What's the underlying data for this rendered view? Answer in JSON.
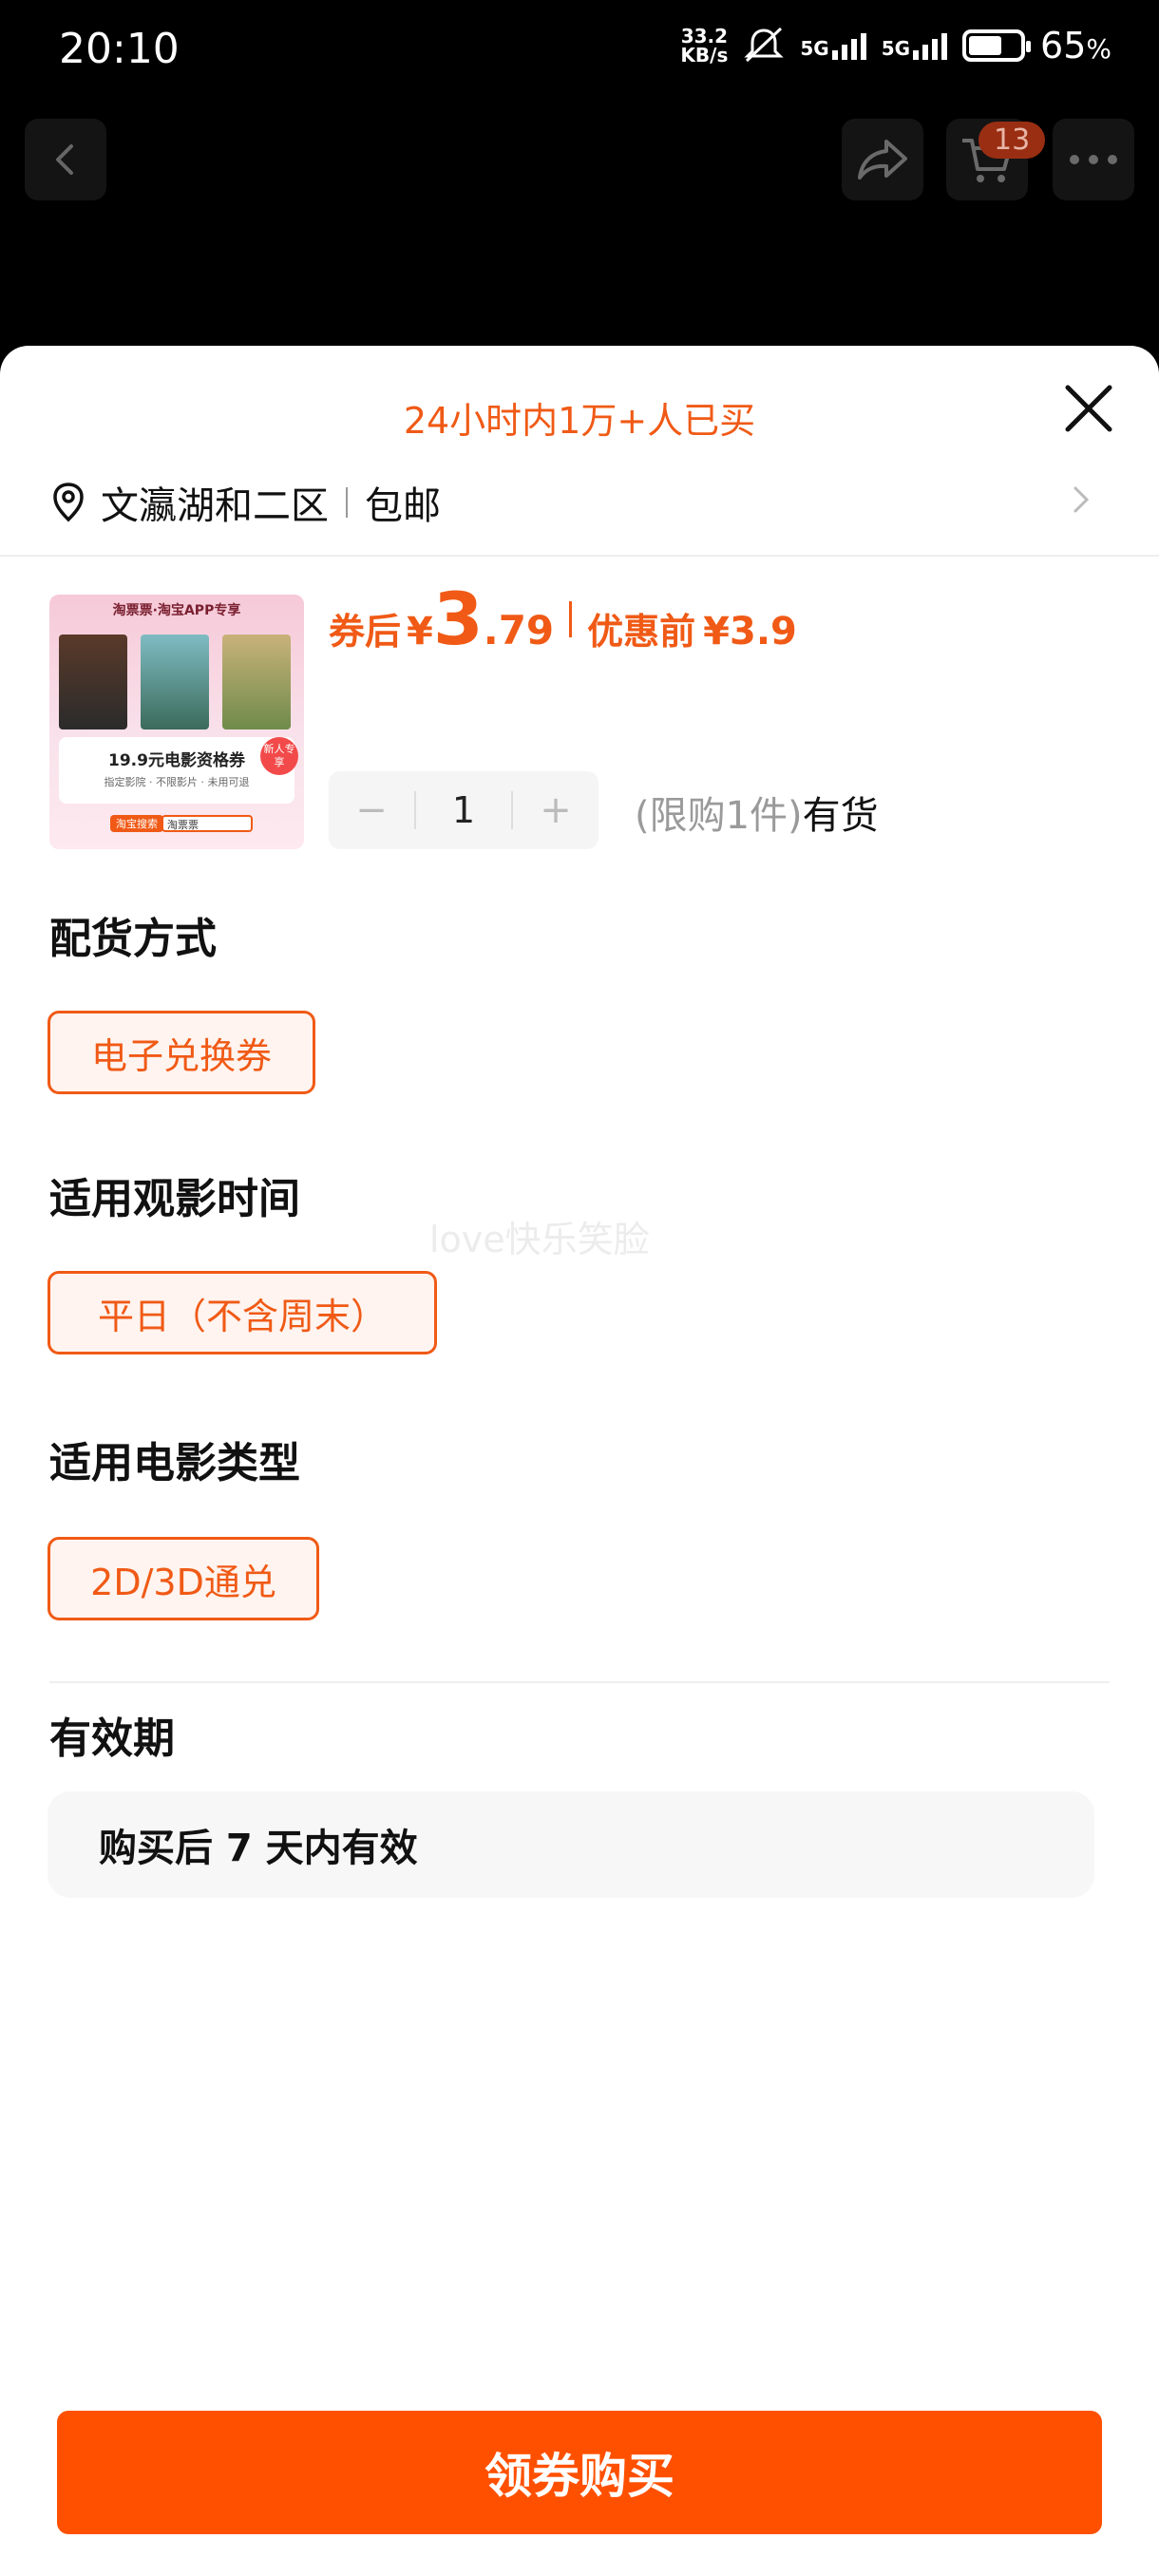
{
  "status_bar": {
    "time": "20:10",
    "net_speed_value": "33.2",
    "net_speed_unit": "KB/s",
    "sim1_label": "5G",
    "sim2_label": "5G",
    "battery_percent": "65",
    "battery_unit": "%",
    "battery_level": 0.65
  },
  "nav": {
    "cart_count": "13",
    "icons": [
      "back-icon",
      "share-icon",
      "cart-icon",
      "more-icon"
    ]
  },
  "sheet": {
    "sold_tip": "24小时内1万+人已买",
    "address": "文瀛湖和二区",
    "shipping": "包邮",
    "product_image": {
      "header": "淘票票·淘宝APP专享",
      "banner_title": "19.9元电影资格券",
      "banner_sub": "指定影院 · 不限影片 · 未用可退",
      "new_tag": "新人专享",
      "footer_brand": "淘宝搜索",
      "footer_search": "淘票票"
    },
    "price": {
      "after_label": "券后",
      "currency": "¥",
      "int": "3",
      "dec": ".79",
      "orig_label": "优惠前",
      "orig_value": "¥3.9"
    },
    "quantity": {
      "minus": "−",
      "value": "1",
      "plus": "+"
    },
    "stock": {
      "limit": "(限购1件)",
      "status": "有货"
    },
    "delivery": {
      "title": "配货方式",
      "option": "电子兑换券"
    },
    "time": {
      "title": "适用观影时间",
      "option": "平日（不含周末）"
    },
    "type": {
      "title": "适用电影类型",
      "option": "2D/3D通兑"
    },
    "watermark": "love快乐笑脸",
    "validity": {
      "title": "有效期",
      "text": "购买后 7 天内有效"
    },
    "buy_button": "领券购买"
  },
  "colors": {
    "accent": "#f05a16",
    "buy_button": "#ff5000"
  }
}
